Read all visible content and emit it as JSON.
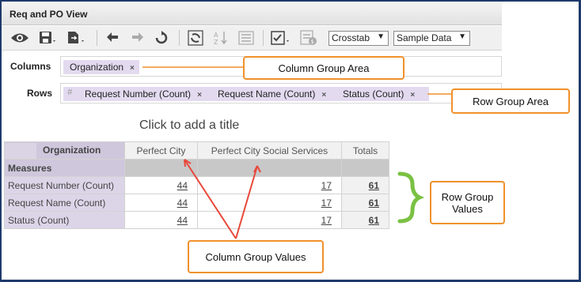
{
  "window": {
    "title": "Req and PO View"
  },
  "toolbar": {
    "crosstab_select": "Crosstab",
    "data_select": "Sample Data",
    "icons": [
      "eye-icon",
      "save-icon",
      "export-icon",
      "undo-icon",
      "redo-icon",
      "reset-icon",
      "pivot-icon",
      "sort-icon",
      "style-icon",
      "options-icon",
      "conditional-format-icon"
    ]
  },
  "shelves": {
    "columns_label": "Columns",
    "rows_label": "Rows",
    "rows_hash": "#",
    "column_fields": [
      "Organization"
    ],
    "row_fields": [
      "Request Number (Count)",
      "Request Name (Count)",
      "Status (Count)"
    ],
    "remove_glyph": "×"
  },
  "report": {
    "title_placeholder": "Click to add a title",
    "corner_label": "Organization",
    "measures_label": "Measures",
    "columns": [
      "Perfect City",
      "Perfect City Social Services",
      "Totals"
    ],
    "rows": [
      {
        "label": "Request Number (Count)",
        "values": [
          "44",
          "17",
          "61"
        ]
      },
      {
        "label": "Request Name (Count)",
        "values": [
          "44",
          "17",
          "61"
        ]
      },
      {
        "label": "Status (Count)",
        "values": [
          "44",
          "17",
          "61"
        ]
      }
    ]
  },
  "annotations": {
    "column_group_area": "Column Group Area",
    "row_group_area": "Row Group Area",
    "row_group_values_line1": "Row Group",
    "row_group_values_line2": "Values",
    "column_group_values": "Column Group Values",
    "callout_color": "#f0912b",
    "arrow_color": "#e8483a",
    "brace_color": "#7ac143"
  }
}
